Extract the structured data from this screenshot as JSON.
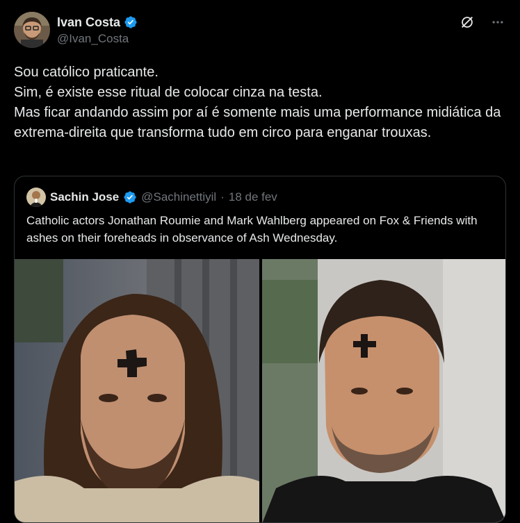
{
  "tweet": {
    "author_name": "Ivan Costa",
    "author_handle": "@Ivan_Costa",
    "lines": [
      "Sou católico praticante.",
      "Sim, é existe esse ritual de colocar cinza na testa.",
      "Mas ficar andando assim por aí é somente mais uma performance midiática da extrema-direita que transforma tudo em circo para enganar trouxas."
    ]
  },
  "icons": {
    "verified": "verified-badge-icon",
    "grok": "grok-icon",
    "more": "more-options-icon"
  },
  "quote": {
    "author_name": "Sachin Jose",
    "author_handle": "@Sachinettiyil",
    "separator": "·",
    "date": "18 de fev",
    "text": "Catholic actors Jonathan Roumie and Mark Wahlberg appeared on Fox & Friends with ashes on their foreheads in observance of Ash Wednesday."
  },
  "colors": {
    "background": "#000000",
    "text": "#e7e9ea",
    "muted": "#71767b",
    "border": "#2f3336",
    "verified": "#1d9bf0"
  }
}
